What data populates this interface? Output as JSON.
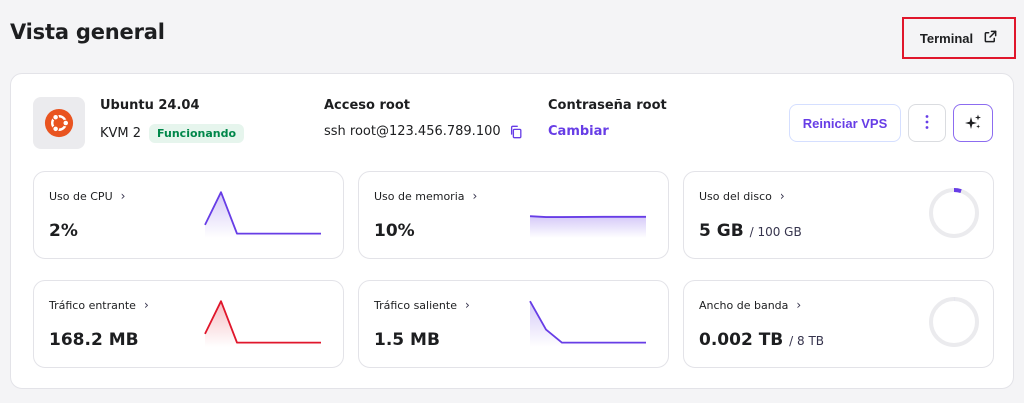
{
  "header": {
    "title": "Vista general",
    "terminal_label": "Terminal"
  },
  "server": {
    "os_name": "Ubuntu 24.04",
    "plan": "KVM 2",
    "status": "Funcionando",
    "root_access_label": "Acceso root",
    "root_access_value": "ssh root@123.456.789.100",
    "password_label": "Contraseña root",
    "password_action": "Cambiar"
  },
  "actions": {
    "restart_label": "Reiniciar VPS"
  },
  "colors": {
    "accent": "#673de6",
    "danger": "#e0162b",
    "inbound": "#fc5185",
    "success": "#00874a",
    "ubuntu": "#e95420"
  },
  "metrics": {
    "cpu": {
      "label": "Uso de CPU",
      "value": "2%",
      "series": [
        6,
        21,
        2,
        2,
        2
      ]
    },
    "memory": {
      "label": "Uso de memoria",
      "value": "10%",
      "series": [
        10,
        9.6,
        9.6,
        9.7,
        9.7
      ]
    },
    "disk": {
      "label": "Uso del disco",
      "value": "5 GB",
      "sub": "/ 100 GB",
      "fraction": 0.05
    },
    "inbound": {
      "label": "Tráfico entrante",
      "value": "168.2 MB",
      "series": [
        6,
        21,
        2,
        2,
        2
      ]
    },
    "outbound": {
      "label": "Tráfico saliente",
      "value": "1.5 MB",
      "series": [
        21,
        8,
        2,
        2,
        2
      ]
    },
    "bandwidth": {
      "label": "Ancho de banda",
      "value": "0.002 TB",
      "sub": "/ 8 TB",
      "fraction": 0.00025
    }
  }
}
